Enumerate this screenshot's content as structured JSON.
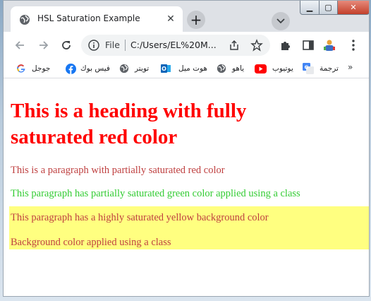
{
  "browser": {
    "tab_title": "HSL Saturation Example",
    "tab_close_glyph": "✕",
    "new_tab_glyph": "+",
    "address": {
      "scheme_label": "File",
      "url": "C:/Users/EL%20M..."
    },
    "window_controls": {
      "minimize": "▁",
      "maximize": "▢",
      "close": "✕"
    },
    "overflow_glyph": "»"
  },
  "bookmarks": [
    {
      "label": "جوجل",
      "icon": "google-icon"
    },
    {
      "label": "فيس بوك",
      "icon": "facebook-icon"
    },
    {
      "label": "تويتر",
      "icon": "globe-icon"
    },
    {
      "label": "هوت ميل",
      "icon": "outlook-icon"
    },
    {
      "label": "ياهو",
      "icon": "globe-icon"
    },
    {
      "label": "يوتيوب",
      "icon": "youtube-icon"
    },
    {
      "label": "ترجمة",
      "icon": "translate-icon"
    }
  ],
  "page": {
    "heading": "This is a heading with fully saturated red color",
    "p1": "This is a paragraph with partially saturated red color",
    "p2": "This paragraph has partially saturated green color applied using a class",
    "p3": "This paragraph has a highly saturated yellow background color",
    "p4": "Background color applied using a class"
  },
  "colors": {
    "heading": "#ff0000",
    "p1": "#bf4040",
    "p2": "#33cc33",
    "yellow_bg": "#ffff80",
    "p34": "#bf4040"
  }
}
